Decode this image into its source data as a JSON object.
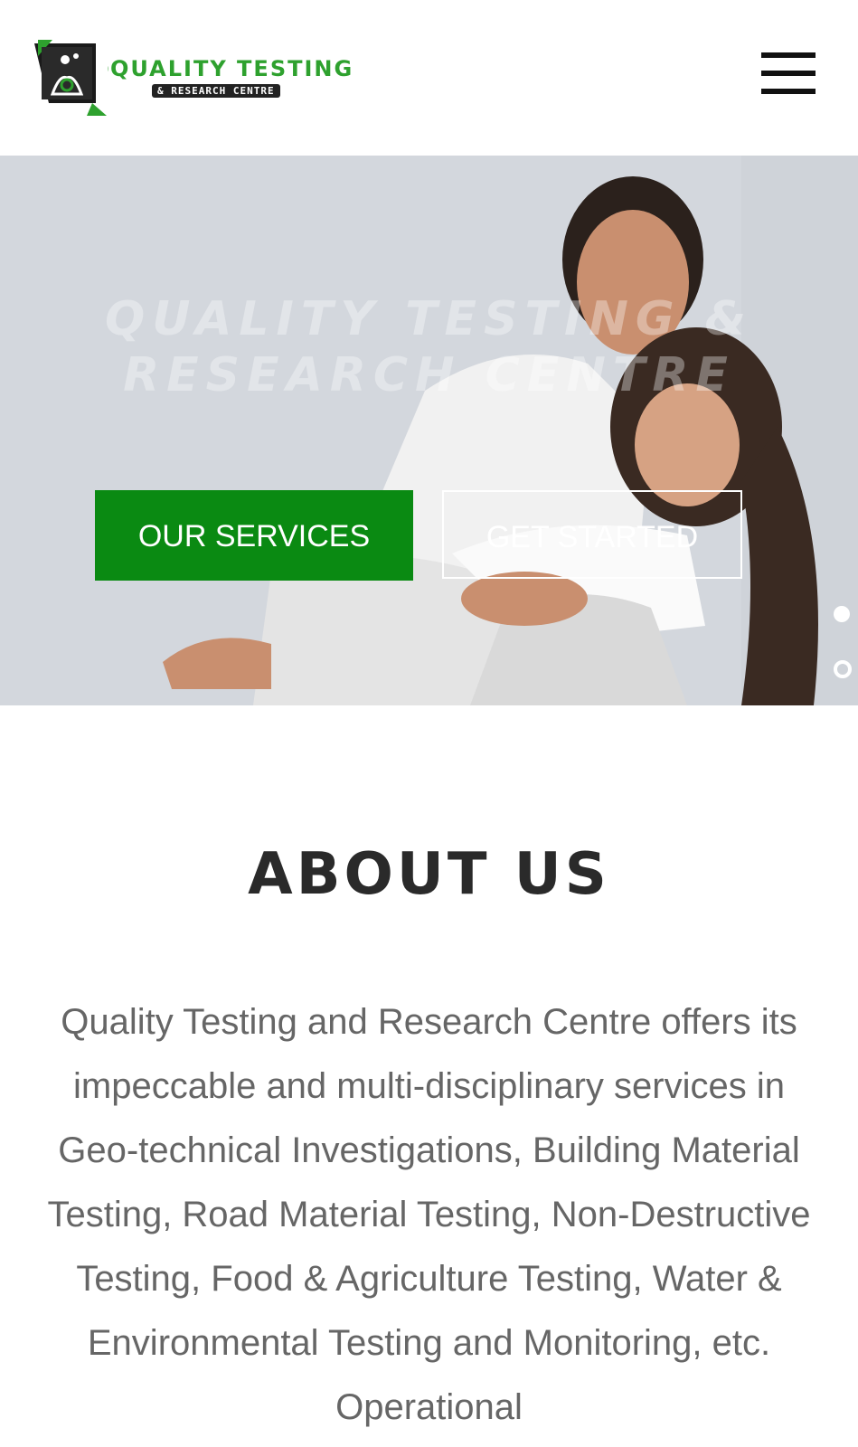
{
  "header": {
    "logo_title": "QUALITY TESTING",
    "logo_subtitle": "& RESEARCH CENTRE",
    "menu_icon": "hamburger-menu-icon"
  },
  "hero": {
    "title_line1": "QUALITY TESTING &",
    "title_line2": "RESEARCH CENTRE",
    "primary_button": "OUR SERVICES",
    "secondary_button": "GET STARTED",
    "slides_count": 2,
    "active_slide": 1,
    "accent_color": "#0a8a12"
  },
  "about": {
    "title": "ABOUT US",
    "text": "Quality Testing and Research Centre offers its impeccable and multi-disciplinary services in Geo-technical Investigations, Building Material Testing, Road Material Testing, Non-Destructive Testing, Food & Agriculture Testing, Water & Environmental Testing and Monitoring, etc. Operational"
  }
}
